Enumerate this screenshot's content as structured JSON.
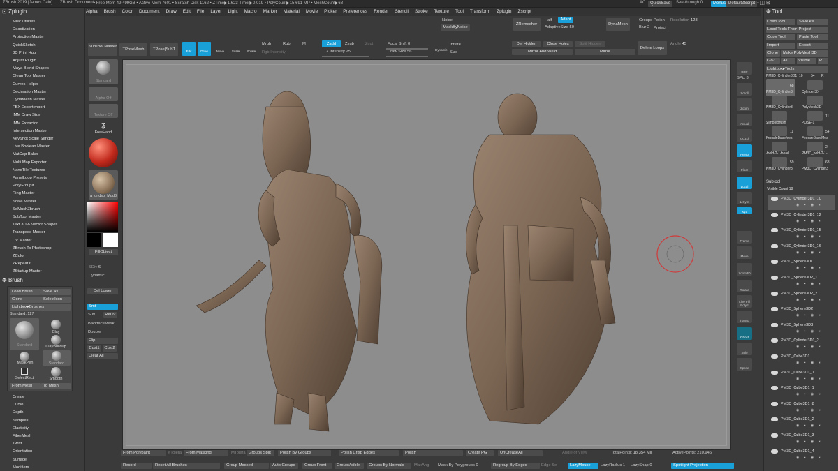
{
  "titlebar": {
    "app": "ZBrush 2019 [James Cain]",
    "doc": "ZBrush Document",
    "stats": "• Free Mem 49.499GB • Active Mem 7601 • Scratch Disk 1162 • ZTime▶1.623 Timer▶0.019 • PolyCount▶15.691 MP • MeshCount▶68",
    "ac": "AC",
    "quicksave": "QuickSave",
    "seethrough": "See-through 0",
    "menus": "Menus",
    "script": "DefaultZScript"
  },
  "menubar": [
    "Alpha",
    "Brush",
    "Color",
    "Document",
    "Draw",
    "Edit",
    "File",
    "Layer",
    "Light",
    "Macro",
    "Marker",
    "Material",
    "Movie",
    "Picker",
    "Preferences",
    "Render",
    "Stencil",
    "Stroke",
    "Texture",
    "Tool",
    "Transform",
    "Zplugin",
    "Zscript"
  ],
  "zplugin": {
    "title": "Zplugin",
    "items": [
      "Misc Utilities",
      "Deactivation",
      "Projection Master",
      "QuickSketch",
      "3D Print Hub",
      "Adjust Plugin",
      "Maya Blend Shapes",
      "Clean Tool Master",
      "Curves Helper",
      "Decimation Master",
      "DynaMesh Master",
      "FBX ExportImport",
      "IMM Draw Size",
      "IMM Extractor",
      "Intersection Masker",
      "KeyShot Scale Sender",
      "Live Boolean Master",
      "MatCap Baker",
      "Multi Map Exporter",
      "NanoTile Textures",
      "PanelLoop Presets",
      "PolyGroupIt",
      "Ring Master",
      "Scale Master",
      "SoMuchZbrush",
      "SubTool Master",
      "Text 3D & Vector Shapes",
      "Transpose Master",
      "UV Master",
      "ZBrush To Photoshop",
      "ZColor",
      "ZRepeat It",
      "ZStartup Master"
    ]
  },
  "brush": {
    "title": "Brush",
    "load": "Load Brush",
    "saveas": "Save As",
    "clone": "Clone",
    "selecticon": "SelectIcon",
    "lightbox": "Lightbox▸Brushes",
    "standard": "Standard. 127",
    "brushes": [
      "Standard",
      "Clay",
      "ClayBuildup",
      "MaskPen",
      "Standard",
      "SelectRect",
      "Smooth"
    ],
    "frommesh": "From Mesh",
    "tomesh": "To Mesh"
  },
  "stroke_list": {
    "items": [
      "Create",
      "Curve",
      "Depth",
      "Samples",
      "Elasticity",
      "FiberMesh",
      "Twist",
      "Orientation",
      "Surface",
      "Modifiers"
    ]
  },
  "topshelf": {
    "subtool_master": "SubTool Master",
    "tposemesh": "TPoseMesh",
    "tpose_subt": "TPose|SubT",
    "edit": "Edit",
    "draw": "Draw",
    "move": "Move",
    "scale": "Scale",
    "rotate": "Rotate",
    "mrgb": "Mrgb",
    "rgb": "Rgb",
    "m": "M",
    "rgb_intensity": "Rgb Intensity",
    "zadd": "Zadd",
    "zsub": "Zsub",
    "zcut": "Zcut",
    "z_intensity": "Z Intensity",
    "z_intensity_val": "25",
    "focal_shift": "Focal Shift",
    "focal_shift_val": "0",
    "draw_size": "Draw Size",
    "draw_size_val": "56",
    "dynamic": "Dynamic",
    "inflate": "Inflate",
    "size": "Size",
    "noise": "Noise",
    "maskbynoise": "MaskByNoise",
    "zremesher": "ZRemesher",
    "half": "Half",
    "adapt": "Adapt",
    "adaptive_size": "AdaptiveSize",
    "adaptive_size_val": "50",
    "dynamesh": "DynaMesh",
    "groups": "Groups",
    "polish": "Polish",
    "resolution": "Resolution",
    "resolution_val": "128",
    "blur": "Blur",
    "blur_val": "2",
    "project": "Project",
    "del_hidden": "Del Hidden",
    "close_holes": "Close Holes",
    "split_hidden": "Split Hidden",
    "mirror_weld": "Mirror And Weld",
    "mirror": "Mirror",
    "delete_loops": "Delete Loops",
    "angle": "Angle",
    "angle_val": "45"
  },
  "leftshelf": {
    "standard": "Standard",
    "alpha_off": "Alpha Off",
    "texture_off": "Texture Off",
    "freehand": "FreeHand",
    "material": "a_undso_Mud3",
    "fillobject": "FillObject",
    "sdiv": "SDiv",
    "sdiv_val": "6",
    "dynamic": "Dynamic",
    "del_lower": "Del Lower",
    "smt": "Smt",
    "suv": "Suv",
    "reuv": "ReUV",
    "backfacemask": "BackfaceMask",
    "double": "Double",
    "flip": "Flip",
    "cust1": "Cust1",
    "cust2": "Cust2",
    "clear_all": "Clear All"
  },
  "rightshelf": {
    "icons": [
      "BPR",
      "Scroll",
      "Zoom",
      "Actual",
      "AAHalf",
      "Persp",
      "Floor",
      "Local",
      "L.Sym",
      "Xyz",
      "Frame",
      "Move",
      "Zoom3D",
      "Rotate",
      "Line Fill PolyF",
      "Transp",
      "Ghost",
      "Solo",
      "Xpose"
    ],
    "spix": "SPix",
    "spix_val": "3"
  },
  "tool": {
    "title": "Tool",
    "load": "Load Tool",
    "saveas": "Save As",
    "loadproject": "Load Tools From Project",
    "copy": "Copy Tool",
    "paste": "Paste Tool",
    "import": "Import",
    "export": "Export",
    "clone": "Clone",
    "makepoly": "Make PolyMesh3D",
    "goz": "GoZ",
    "all": "All",
    "visible": "Visible",
    "r": "R",
    "lightbox": "Lightbox▸Tools",
    "current": "PM3D_Cylinder3D1_10",
    "current_count": "54",
    "current_r": "R",
    "thumbs": [
      {
        "label": "PM3D_Cylinder3",
        "count": "68"
      },
      {
        "label": "Cylinder3D",
        "count": ""
      },
      {
        "label": "PM3D_Cylinder3",
        "count": ""
      },
      {
        "label": "PolyMesh3D",
        "count": ""
      },
      {
        "label": "SimpleBrush",
        "count": ""
      },
      {
        "label": "POSE-1",
        "count": "11"
      },
      {
        "label": "FemaleBaseMes",
        "count": "11"
      },
      {
        "label": "FemaleBaseMes",
        "count": "54"
      },
      {
        "label": "-bold-2-1-head",
        "count": ""
      },
      {
        "label": "PM3D_bold-2-1-",
        "count": "2"
      },
      {
        "label": "PM3D_Cylinder3",
        "count": "59"
      },
      {
        "label": "PM3D_Cylinder3",
        "count": "68"
      }
    ],
    "subtool": "Subtool",
    "visible_count": "Visible Count",
    "visible_count_val": "18",
    "subtools": [
      "PM3D_Cylinder3D1_10",
      "PM3D_Cylinder3D1_12",
      "PM3D_Cylinder3D1_15",
      "PM3D_Cylinder3D1_16",
      "PM3D_Sphere3D1",
      "PM3D_Sphere3D2_1",
      "PM3D_Sphere3D2_2",
      "PM3D_Sphere3D2",
      "PM3D_Sphere3D3",
      "PM3D_Cylinder3D1_2",
      "PM3D_Cube3D1",
      "PM3D_Cube3D1_1",
      "PM3D_Cube3D1_1",
      "PM3D_Cube3D1_8",
      "PM3D_Cube3D1_2",
      "PM3D_Cube3D1_3",
      "PM3D_Cube3D1_4"
    ]
  },
  "bottombar": {
    "from_polypaint": "From Polypaint",
    "polygroupify": "#Tolera",
    "from_masking": "From Masking",
    "mtoler": "MTolera",
    "groups_split": "Groups Split",
    "polish_groups": "Polish By Groups",
    "polish_crisp": "Polish Crisp Edges",
    "polish": "Polish",
    "create_pg": "Create PG",
    "uncrease_all": "UnCreaseAll",
    "angle_of_view": "Angle of View",
    "total_points": "TotalPoints: 18.354 Mil",
    "active_points": "ActivePoints: 210,946",
    "record": "Record",
    "reset_brushes": "Reset All Brushes",
    "group_masked": "Group Masked",
    "auto_groups": "Auto Groups",
    "group_front": "Group Front",
    "group_visible": "GroupVisible",
    "groups_normals": "Groups By Normals",
    "maxang": "MaxAng",
    "maskbypoly": "Mask By Polygroups",
    "maskbypoly_val": "0",
    "regroup_edges": "Regroup By Edges",
    "edge_s": "Edge Se",
    "lazymouse": "LazyMouse",
    "lazyradius": "LazyRadius",
    "lazyradius_val": "1",
    "lazysnap": "LazySnap",
    "lazysnap_val": "0",
    "spotlight": "Spotlight Projection"
  },
  "colors": {
    "accent": "#1aa0d8",
    "figure": "#7f6a57",
    "viewport": "#8d8d8d",
    "brush_ring": "#d03a3a"
  }
}
